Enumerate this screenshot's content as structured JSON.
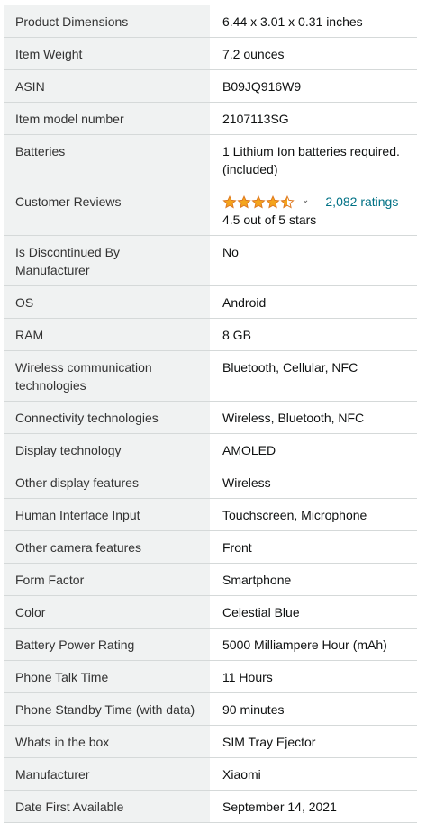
{
  "specs": [
    {
      "label": "Product Dimensions",
      "value": "6.44 x 3.01 x 0.31 inches"
    },
    {
      "label": "Item Weight",
      "value": "7.2 ounces"
    },
    {
      "label": "ASIN",
      "value": "B09JQ916W9"
    },
    {
      "label": "Item model number",
      "value": "2107113SG"
    },
    {
      "label": "Batteries",
      "value": "1 Lithium Ion batteries required. (included)"
    },
    {
      "label": "Customer Reviews",
      "value": "4.5 out of 5 stars"
    },
    {
      "label": "Is Discontinued By Manufacturer",
      "value": "No"
    },
    {
      "label": "OS",
      "value": "Android"
    },
    {
      "label": "RAM",
      "value": "8 GB"
    },
    {
      "label": "Wireless communication technologies",
      "value": "Bluetooth, Cellular, NFC"
    },
    {
      "label": "Connectivity technologies",
      "value": "Wireless, Bluetooth, NFC"
    },
    {
      "label": "Display technology",
      "value": "AMOLED"
    },
    {
      "label": "Other display features",
      "value": "Wireless"
    },
    {
      "label": "Human Interface Input",
      "value": "Touchscreen, Microphone"
    },
    {
      "label": "Other camera features",
      "value": "Front"
    },
    {
      "label": "Form Factor",
      "value": "Smartphone"
    },
    {
      "label": "Color",
      "value": "Celestial Blue"
    },
    {
      "label": "Battery Power Rating",
      "value": "5000 Milliampere Hour (mAh)"
    },
    {
      "label": "Phone Talk Time",
      "value": "11 Hours"
    },
    {
      "label": "Phone Standby Time (with data)",
      "value": "90 minutes"
    },
    {
      "label": "Whats in the box",
      "value": "SIM Tray Ejector"
    },
    {
      "label": "Manufacturer",
      "value": "Xiaomi"
    },
    {
      "label": "Date First Available",
      "value": "September 14, 2021"
    }
  ],
  "reviews": {
    "rating": 4.5,
    "max_rating": 5,
    "ratings_link": "2,082 ratings",
    "star_icon": "star-icon",
    "dropdown_icon": "chevron-down-icon",
    "star_color": "#f4a41c",
    "link_color": "#007185"
  }
}
